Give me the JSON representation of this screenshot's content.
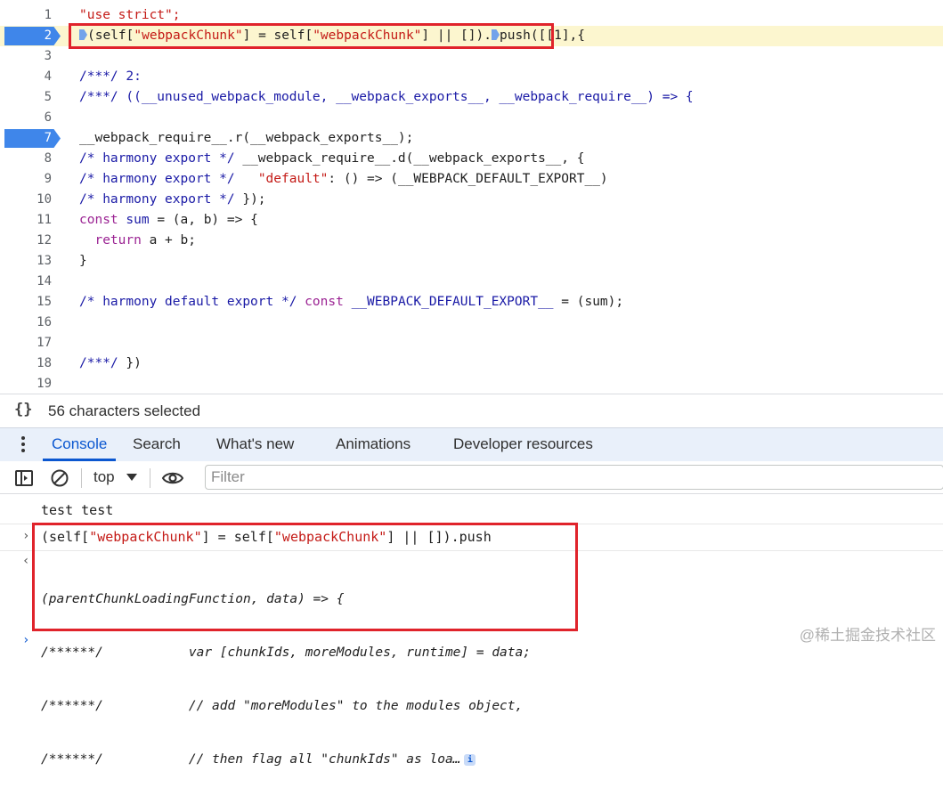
{
  "editor": {
    "lines": [
      {
        "num": "1"
      },
      {
        "num": "2"
      },
      {
        "num": "3"
      },
      {
        "num": "4"
      },
      {
        "num": "5"
      },
      {
        "num": "6"
      },
      {
        "num": "7"
      },
      {
        "num": "8"
      },
      {
        "num": "9"
      },
      {
        "num": "10"
      },
      {
        "num": "11"
      },
      {
        "num": "12"
      },
      {
        "num": "13"
      },
      {
        "num": "14"
      },
      {
        "num": "15"
      },
      {
        "num": "16"
      },
      {
        "num": "17"
      },
      {
        "num": "18"
      },
      {
        "num": "19"
      }
    ],
    "breakpoint_lines": [
      "2",
      "7"
    ],
    "highlight_line": "2",
    "code": {
      "l1": "\"use strict\";",
      "l2_a": "(self[",
      "l2_b": "\"webpackChunk\"",
      "l2_c": "] = self[",
      "l2_d": "\"webpackChunk\"",
      "l2_e": "] || []).",
      "l2_f": "push([[1],{",
      "l4_a": "/***/",
      "l4_b": " 2:",
      "l5_a": "/***/",
      "l5_b": " ((__unused_webpack_module, __webpack_exports__, __webpack_require__) => {",
      "l7": "__webpack_require__.r(__webpack_exports__);",
      "l8_a": "/* harmony export */",
      "l8_b": " __webpack_require__.d(__webpack_exports__, {",
      "l9_a": "/* harmony export */",
      "l9_b": "   ",
      "l9_c": "\"default\"",
      "l9_d": ": () => (__WEBPACK_DEFAULT_EXPORT__)",
      "l10_a": "/* harmony export */",
      "l10_b": " });",
      "l11_a": "const",
      "l11_b": " ",
      "l11_c": "sum",
      "l11_d": " = (a, b) => {",
      "l12_a": "  ",
      "l12_b": "return",
      "l12_c": " a + b;",
      "l13": "}",
      "l15_a": "/* harmony default export */",
      "l15_b": " ",
      "l15_c": "const",
      "l15_d": " ",
      "l15_e": "__WEBPACK_DEFAULT_EXPORT__",
      "l15_f": " = (sum);",
      "l18_a": "/***/",
      "l18_b": " })"
    }
  },
  "status": {
    "icon": "curly-braces-icon",
    "braces": "{}",
    "text": "56 characters selected"
  },
  "drawer": {
    "tabs": [
      "Console",
      "Search",
      "What's new",
      "Animations",
      "Developer resources"
    ],
    "active_tab": "Console",
    "accent": "#0b57d0"
  },
  "console_toolbar": {
    "context": "top",
    "filter_placeholder": "Filter",
    "icons": [
      "sidebar-toggle-icon",
      "clear-console-icon",
      "eye-icon"
    ]
  },
  "console": {
    "log_text": "test test",
    "input": {
      "prompt": "›",
      "a": "(self[",
      "b": "\"webpackChunk\"",
      "c": "] = self[",
      "d": "\"webpackChunk\"",
      "e": "] || []).push"
    },
    "result": {
      "prompt": "‹",
      "lines": [
        "(parentChunkLoadingFunction, data) => {",
        "/******/           var [chunkIds, moreModules, runtime] = data;",
        "/******/           // add \"moreModules\" to the modules object,",
        "/******/           // then flag all \"chunkIds\" as loa…"
      ],
      "info_glyph": "i"
    },
    "next_prompt": "›"
  },
  "watermark": "@稀土掘金技术社区",
  "colors": {
    "breakpoint": "#3f86ea",
    "selection_box": "#e0232b",
    "line_highlight": "#fcf6cf",
    "string": "#c41a16",
    "keyword": "#9b2393",
    "comment": "#1a1aa6"
  }
}
